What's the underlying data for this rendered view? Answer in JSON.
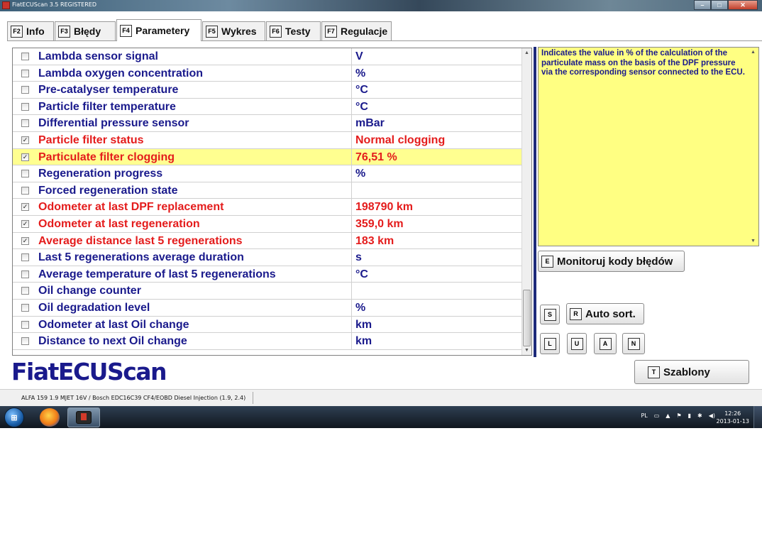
{
  "window": {
    "title": "FiatECUScan 3.5 REGISTERED"
  },
  "tabs": [
    {
      "key": "F2",
      "label": "Info"
    },
    {
      "key": "F3",
      "label": "Błędy"
    },
    {
      "key": "F4",
      "label": "Parametery"
    },
    {
      "key": "F5",
      "label": "Wykres"
    },
    {
      "key": "F6",
      "label": "Testy"
    },
    {
      "key": "F7",
      "label": "Regulacje"
    }
  ],
  "active_tab": "Parametery",
  "parameters": [
    {
      "name": "Lambda sensor signal",
      "value": "V",
      "checked": false
    },
    {
      "name": "Lambda oxygen concentration",
      "value": "%",
      "checked": false
    },
    {
      "name": "Pre-catalyser temperature",
      "value": "°C",
      "checked": false
    },
    {
      "name": "Particle filter temperature",
      "value": "°C",
      "checked": false
    },
    {
      "name": "Differential pressure sensor",
      "value": "mBar",
      "checked": false
    },
    {
      "name": "Particle filter status",
      "value": "Normal clogging",
      "checked": true
    },
    {
      "name": "Particulate filter clogging",
      "value": "76,51 %",
      "checked": true
    },
    {
      "name": "Regeneration progress",
      "value": "%",
      "checked": false
    },
    {
      "name": "Forced regeneration state",
      "value": "",
      "checked": false
    },
    {
      "name": "Odometer at last DPF replacement",
      "value": "198790 km",
      "checked": true
    },
    {
      "name": "Odometer at last regeneration",
      "value": "359,0 km",
      "checked": true
    },
    {
      "name": "Average distance last 5 regenerations",
      "value": "183 km",
      "checked": true
    },
    {
      "name": "Last 5 regenerations average duration",
      "value": "s",
      "checked": false
    },
    {
      "name": "Average temperature of last 5 regenerations",
      "value": "°C",
      "checked": false
    },
    {
      "name": "Oil change counter",
      "value": "",
      "checked": false
    },
    {
      "name": "Oil degradation level",
      "value": "%",
      "checked": false
    },
    {
      "name": "Odometer at last Oil change",
      "value": "km",
      "checked": false
    },
    {
      "name": "Distance to next Oil change",
      "value": "km",
      "checked": false
    }
  ],
  "selected_parameter": "Particulate filter clogging",
  "description": "Indicates the value in % of the calculation of the particulate mass on the basis of the DPF pressure via the corresponding sensor connected to the ECU.",
  "buttons": {
    "monitor": {
      "key": "E",
      "label": "Monitoruj kody błędów"
    },
    "s_key": "S",
    "autosort": {
      "key": "R",
      "label": "Auto sort."
    },
    "l_key": "L",
    "u_key": "U",
    "a_key": "A",
    "n_key": "N",
    "templates": {
      "key": "T",
      "label": "Szablony"
    }
  },
  "logo": "FiatECUScan",
  "status_bar": {
    "vehicle": "ALFA 159 1.9 MJET 16V / Bosch EDC16C39 CF4/EOBD Diesel Injection (1.9, 2.4)"
  },
  "taskbar": {
    "language": "PL",
    "time": "12:26",
    "date": "2013-01-13",
    "icons": [
      "start-orb-icon",
      "firefox-icon",
      "fiatecuscan-app-icon"
    ]
  },
  "colors": {
    "param_text": "#1a1a8c",
    "active_param_text": "#e41c1c",
    "selected_row_bg": "#ffff90",
    "description_bg": "#ffff82"
  }
}
